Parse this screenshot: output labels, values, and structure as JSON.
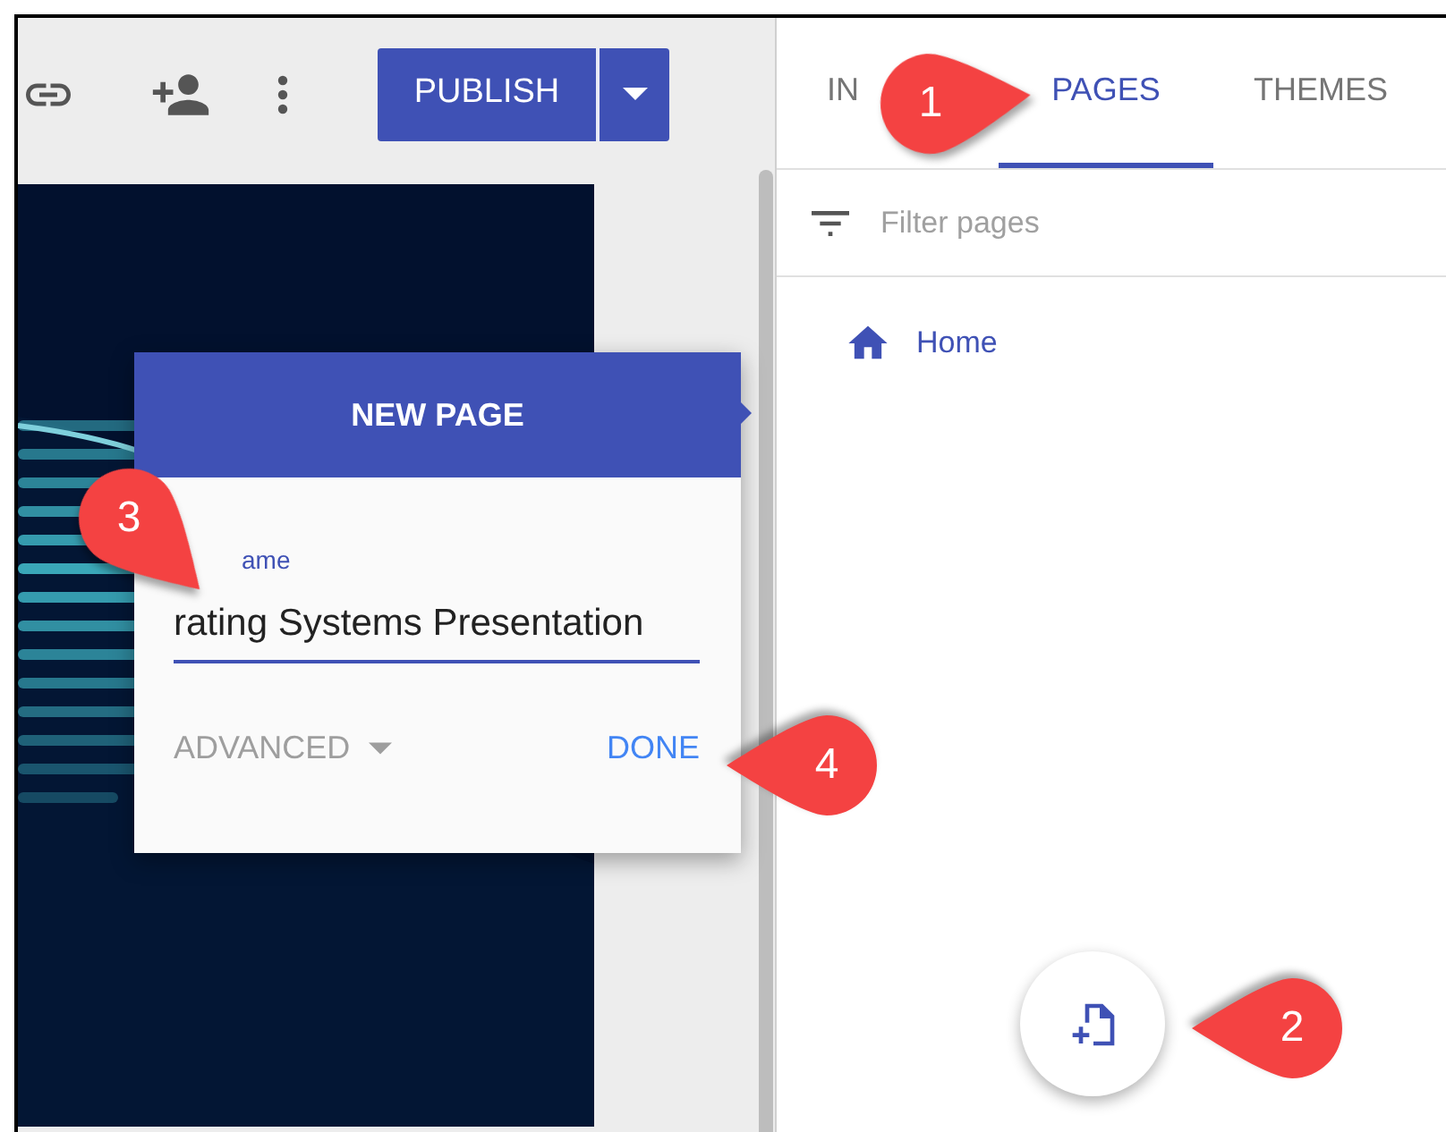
{
  "toolbar": {
    "publish_label": "PUBLISH"
  },
  "tabs": [
    {
      "label": "IN",
      "selected": false
    },
    {
      "label": "PAGES",
      "selected": true
    },
    {
      "label": "THEMES",
      "selected": false
    }
  ],
  "filter": {
    "placeholder": "Filter pages"
  },
  "pages": [
    {
      "label": "Home"
    }
  ],
  "new_page_dialog": {
    "title": "NEW PAGE",
    "field_label": "ame",
    "field_value": "rating Systems Presentation",
    "advanced_label": "ADVANCED",
    "done_label": "DONE"
  },
  "callouts": [
    {
      "number": "1",
      "kind": "right"
    },
    {
      "number": "2",
      "kind": "left"
    },
    {
      "number": "3",
      "kind": "downright"
    },
    {
      "number": "4",
      "kind": "left"
    }
  ]
}
